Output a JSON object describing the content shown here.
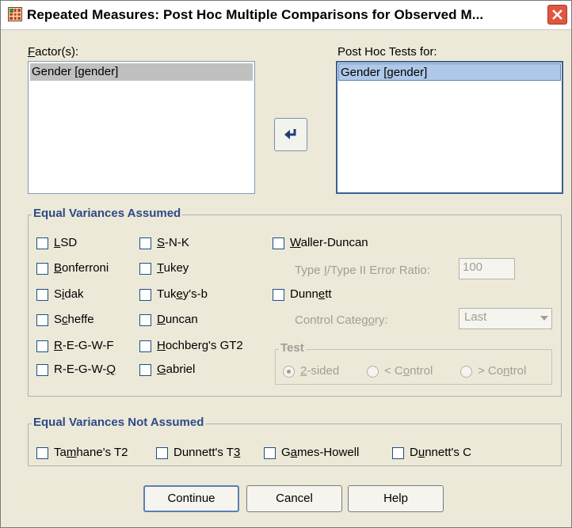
{
  "window": {
    "title": "Repeated Measures: Post Hoc Multiple Comparisons for Observed M...",
    "icon": "app-icon",
    "close_icon": "close-icon"
  },
  "factors": {
    "label_pre": "",
    "label_u": "F",
    "label_post": "actor(s):",
    "items": [
      "Gender [gender]"
    ]
  },
  "post_hoc": {
    "label": "Post Hoc Tests for:",
    "items": [
      "Gender [gender]"
    ]
  },
  "move_button": {
    "icon": "arrow-left-icon"
  },
  "equal_assumed": {
    "title": "Equal Variances Assumed",
    "col1": [
      {
        "pre": "",
        "u": "L",
        "post": "SD"
      },
      {
        "pre": "",
        "u": "B",
        "post": "onferroni"
      },
      {
        "pre": "S",
        "u": "i",
        "post": "dak"
      },
      {
        "pre": "S",
        "u": "c",
        "post": "heffe"
      },
      {
        "pre": "",
        "u": "R",
        "post": "-E-G-W-F"
      },
      {
        "pre": "R-E-G-W-",
        "u": "Q",
        "post": ""
      }
    ],
    "col2": [
      {
        "pre": "",
        "u": "S",
        "post": "-N-K"
      },
      {
        "pre": "",
        "u": "T",
        "post": "ukey"
      },
      {
        "pre": "Tuk",
        "u": "e",
        "post": "y's-b"
      },
      {
        "pre": "",
        "u": "D",
        "post": "uncan"
      },
      {
        "pre": "",
        "u": "H",
        "post": "ochberg's GT2"
      },
      {
        "pre": "",
        "u": "G",
        "post": "abriel"
      }
    ],
    "waller": {
      "pre": "",
      "u": "W",
      "post": "aller-Duncan"
    },
    "error_ratio_label": {
      "pre": "Type ",
      "u": "I",
      "post": "/Type II Error Ratio:"
    },
    "error_ratio_value": "100",
    "dunnett": {
      "pre": "Dunn",
      "u": "e",
      "post": "tt"
    },
    "control_category_label": {
      "pre": "Control Categ",
      "u": "o",
      "post": "ry:"
    },
    "control_category_value": "Last",
    "test_title": "Test",
    "test_options": [
      {
        "pre": "",
        "u": "2",
        "post": "-sided",
        "selected": true
      },
      {
        "pre": "< C",
        "u": "o",
        "post": "ntrol",
        "selected": false
      },
      {
        "pre": "> Co",
        "u": "n",
        "post": "trol",
        "selected": false
      }
    ]
  },
  "equal_not_assumed": {
    "title": "Equal Variances Not Assumed",
    "items": [
      {
        "pre": "Ta",
        "u": "m",
        "post": "hane's T2"
      },
      {
        "pre": "Dunnett's T",
        "u": "3",
        "post": ""
      },
      {
        "pre": "G",
        "u": "a",
        "post": "mes-Howell"
      },
      {
        "pre": "D",
        "u": "u",
        "post": "nnett's C"
      }
    ]
  },
  "buttons": {
    "continue": "Continue",
    "cancel": "Cancel",
    "help": "Help"
  },
  "colors": {
    "group_title": "#2e4a87",
    "disabled_text": "#a09f96",
    "selection_blue": "#aec8e8",
    "selection_gray": "#c0c0c0"
  }
}
